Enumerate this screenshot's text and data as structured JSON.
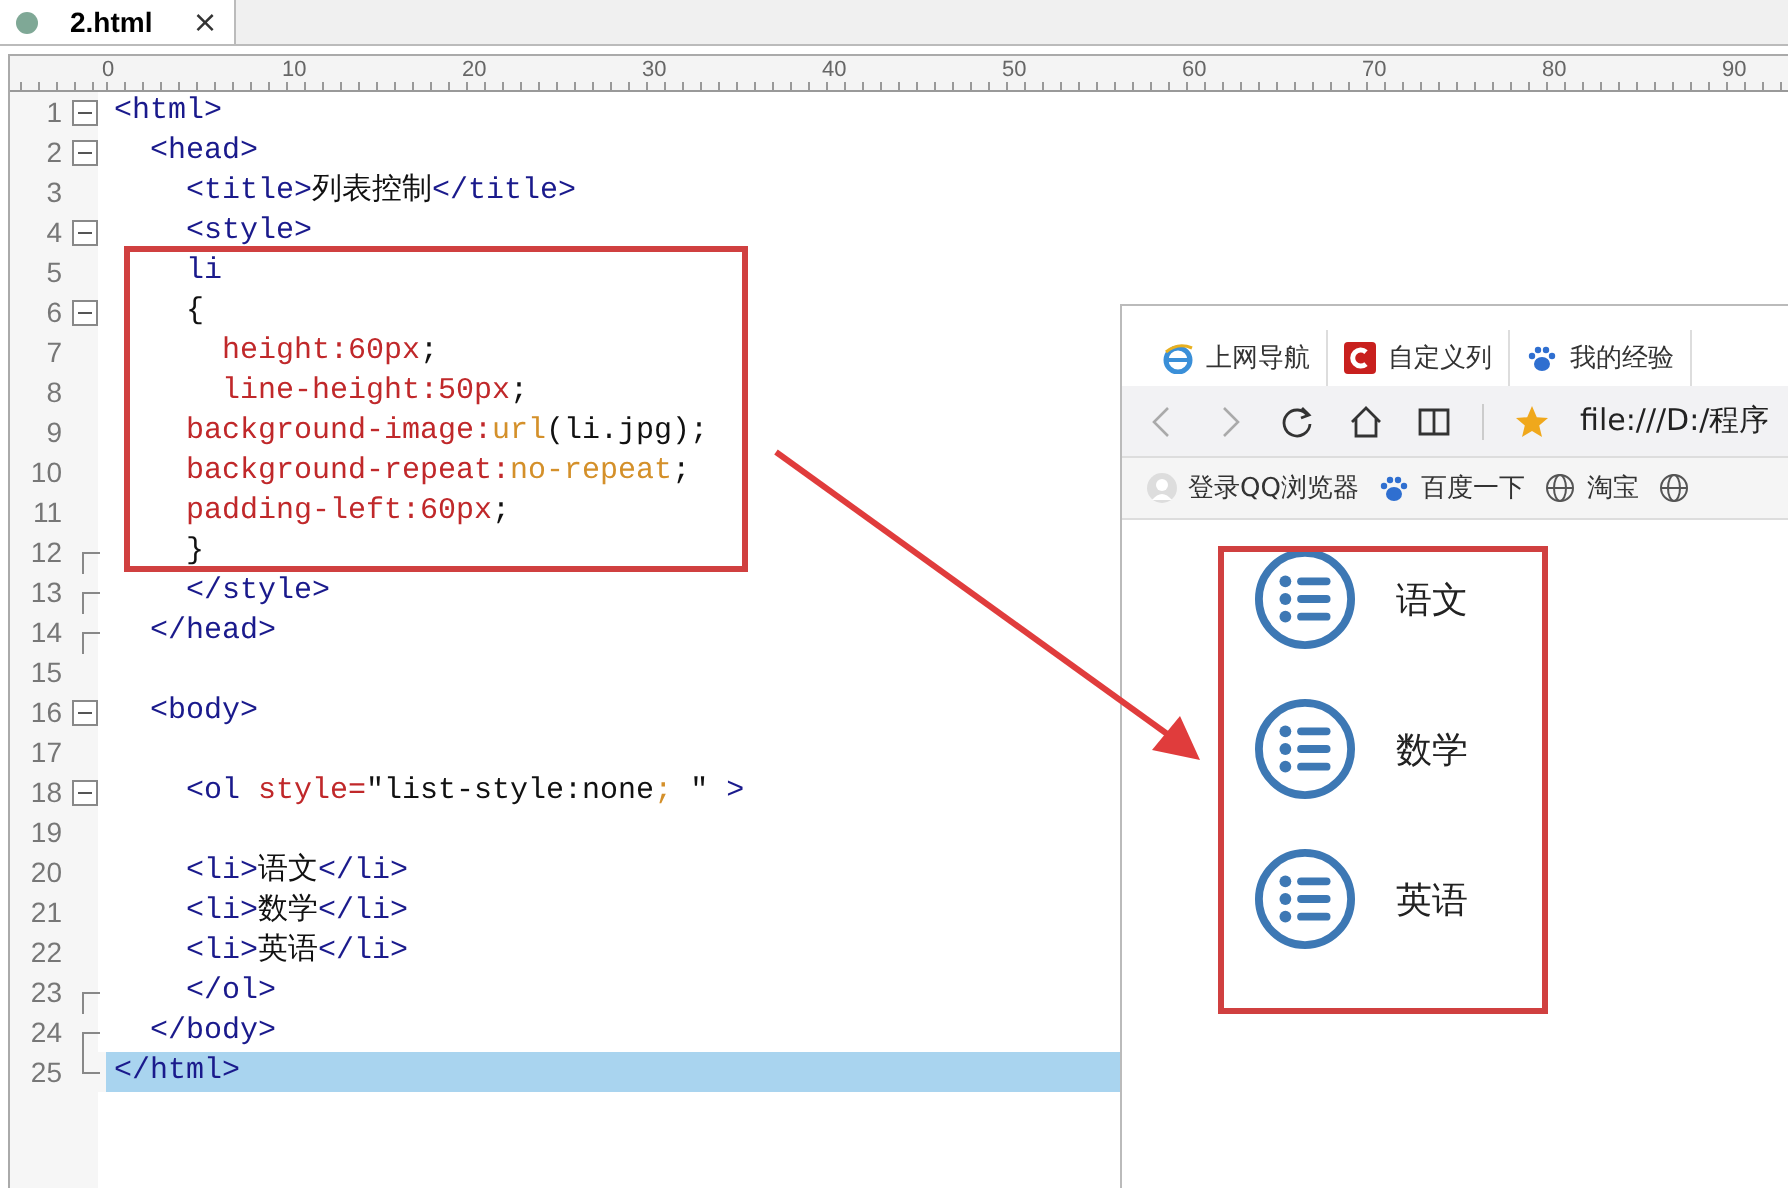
{
  "editor": {
    "tabs": [
      {
        "label": "2.html",
        "close": "×",
        "selected": true
      }
    ],
    "ruler": {
      "labels": [
        "0",
        "10",
        "20",
        "30",
        "40",
        "50",
        "60",
        "70",
        "80",
        "90"
      ]
    },
    "lines": [
      {
        "number": "1",
        "kind": "fold-start",
        "selected": false,
        "tokens": [
          {
            "text": "<html>",
            "kind": "tag"
          }
        ]
      },
      {
        "number": "2",
        "kind": "fold-start",
        "selected": false,
        "tokens": [
          {
            "text": "  <head>",
            "kind": "tag"
          }
        ]
      },
      {
        "number": "3",
        "kind": "plain",
        "selected": false,
        "tokens": [
          {
            "text": "    <title>",
            "kind": "tag"
          },
          {
            "text": "列表控制",
            "kind": "text"
          },
          {
            "text": "</title>",
            "kind": "tag"
          }
        ]
      },
      {
        "number": "4",
        "kind": "fold-start",
        "selected": false,
        "tokens": [
          {
            "text": "    <style>",
            "kind": "tag"
          }
        ]
      },
      {
        "number": "5",
        "kind": "plain",
        "selected": false,
        "tokens": [
          {
            "text": "    li",
            "kind": "tag"
          }
        ]
      },
      {
        "number": "6",
        "kind": "fold-start",
        "selected": false,
        "tokens": [
          {
            "text": "    {",
            "kind": "text"
          }
        ]
      },
      {
        "number": "7",
        "kind": "plain",
        "selected": false,
        "tokens": [
          {
            "text": "      height:60px",
            "kind": "attr"
          },
          {
            "text": ";",
            "kind": "text"
          }
        ]
      },
      {
        "number": "8",
        "kind": "plain",
        "selected": false,
        "tokens": [
          {
            "text": "      line-height:50px",
            "kind": "attr"
          },
          {
            "text": ";",
            "kind": "text"
          }
        ]
      },
      {
        "number": "9",
        "kind": "plain",
        "selected": false,
        "tokens": [
          {
            "text": "    background-image:",
            "kind": "attr"
          },
          {
            "text": "url",
            "kind": "value"
          },
          {
            "text": "(li.jpg);",
            "kind": "text"
          }
        ]
      },
      {
        "number": "10",
        "kind": "plain",
        "selected": false,
        "tokens": [
          {
            "text": "    background-repeat:",
            "kind": "attr"
          },
          {
            "text": "no-repeat",
            "kind": "value"
          },
          {
            "text": ";",
            "kind": "text"
          }
        ]
      },
      {
        "number": "11",
        "kind": "plain",
        "selected": false,
        "tokens": [
          {
            "text": "    padding-left:60px",
            "kind": "attr"
          },
          {
            "text": ";",
            "kind": "text"
          }
        ]
      },
      {
        "number": "12",
        "kind": "fold-end",
        "selected": false,
        "tokens": [
          {
            "text": "    }",
            "kind": "text"
          }
        ]
      },
      {
        "number": "13",
        "kind": "fold-end",
        "selected": false,
        "tokens": [
          {
            "text": "    </style>",
            "kind": "tag"
          }
        ]
      },
      {
        "number": "14",
        "kind": "fold-end",
        "selected": false,
        "tokens": [
          {
            "text": "  </head>",
            "kind": "tag"
          }
        ]
      },
      {
        "number": "15",
        "kind": "plain",
        "selected": false
      },
      {
        "number": "16",
        "kind": "fold-start",
        "selected": false,
        "tokens": [
          {
            "text": "  <body>",
            "kind": "tag"
          }
        ]
      },
      {
        "number": "17",
        "kind": "plain",
        "selected": false
      },
      {
        "number": "18",
        "kind": "fold-start",
        "selected": false,
        "tokens": [
          {
            "text": "    <ol ",
            "kind": "tag"
          },
          {
            "text": "style=",
            "kind": "attr"
          },
          {
            "text": "\"list-style:none",
            "kind": "text"
          },
          {
            "text": ";",
            "kind": "value"
          },
          {
            "text": " \" ",
            "kind": "text"
          },
          {
            "text": ">",
            "kind": "tag"
          }
        ]
      },
      {
        "number": "19",
        "kind": "plain",
        "selected": false
      },
      {
        "number": "20",
        "kind": "plain",
        "selected": false,
        "tokens": [
          {
            "text": "    <li>",
            "kind": "tag"
          },
          {
            "text": "语文",
            "kind": "text"
          },
          {
            "text": "</li>",
            "kind": "tag"
          }
        ]
      },
      {
        "number": "21",
        "kind": "plain",
        "selected": false,
        "tokens": [
          {
            "text": "    <li>",
            "kind": "tag"
          },
          {
            "text": "数学",
            "kind": "text"
          },
          {
            "text": "</li>",
            "kind": "tag"
          }
        ]
      },
      {
        "number": "22",
        "kind": "plain",
        "selected": false,
        "tokens": [
          {
            "text": "    <li>",
            "kind": "tag"
          },
          {
            "text": "英语",
            "kind": "text"
          },
          {
            "text": "</li>",
            "kind": "tag"
          }
        ]
      },
      {
        "number": "23",
        "kind": "fold-end",
        "selected": false,
        "tokens": [
          {
            "text": "    </ol>",
            "kind": "tag"
          }
        ]
      },
      {
        "number": "24",
        "kind": "fold-end",
        "selected": false,
        "tokens": [
          {
            "text": "  </body>",
            "kind": "tag"
          }
        ]
      },
      {
        "number": "25",
        "kind": "fold-last",
        "selected": true,
        "tokens": [
          {
            "text": "</html>",
            "kind": "tag"
          }
        ]
      }
    ]
  },
  "browser": {
    "tabs": [
      {
        "label": "上网导航"
      },
      {
        "label": "自定义列"
      },
      {
        "label": "我的经验"
      }
    ],
    "address": "file:///D:/程序",
    "bookmarks": [
      {
        "label": "登录QQ浏览器"
      },
      {
        "label": "百度一下"
      },
      {
        "label": "淘宝"
      }
    ],
    "list_items": [
      "语文",
      "数学",
      "英语"
    ]
  }
}
